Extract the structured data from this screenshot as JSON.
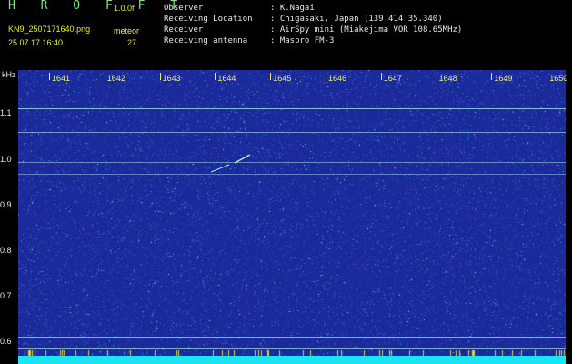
{
  "header": {
    "app_title": "H R O F F T",
    "version": "1.0.0f",
    "filename": "KN9_2507171640.png",
    "meteor_label": "meteor",
    "timestamp": "25.07.17 16:40",
    "meteor_count": "27",
    "info": [
      {
        "key": "Observer",
        "value": ": K.Nagai"
      },
      {
        "key": "Receiving Location",
        "value": ": Chigasaki, Japan (139.414 35.340)"
      },
      {
        "key": "Receiver",
        "value": ": AirSpy mini (Miakejima VOR 108.65MHz)"
      },
      {
        "key": "Receiving antenna",
        "value": ": Maspro FM-3"
      }
    ]
  },
  "spectrogram": {
    "y_unit": "kHz",
    "y_ticks": [
      "1.1",
      "1.0",
      "0.9",
      "0.8",
      "0.7",
      "0.6"
    ],
    "x_ticks": [
      "1641",
      "1642",
      "1643",
      "1644",
      "1645",
      "1646",
      "1647",
      "1648",
      "1649",
      "1650"
    ],
    "background_color": "#1b2a9a",
    "line_color": "#8fd0e0",
    "baseband_color": "#18e6f5"
  }
}
